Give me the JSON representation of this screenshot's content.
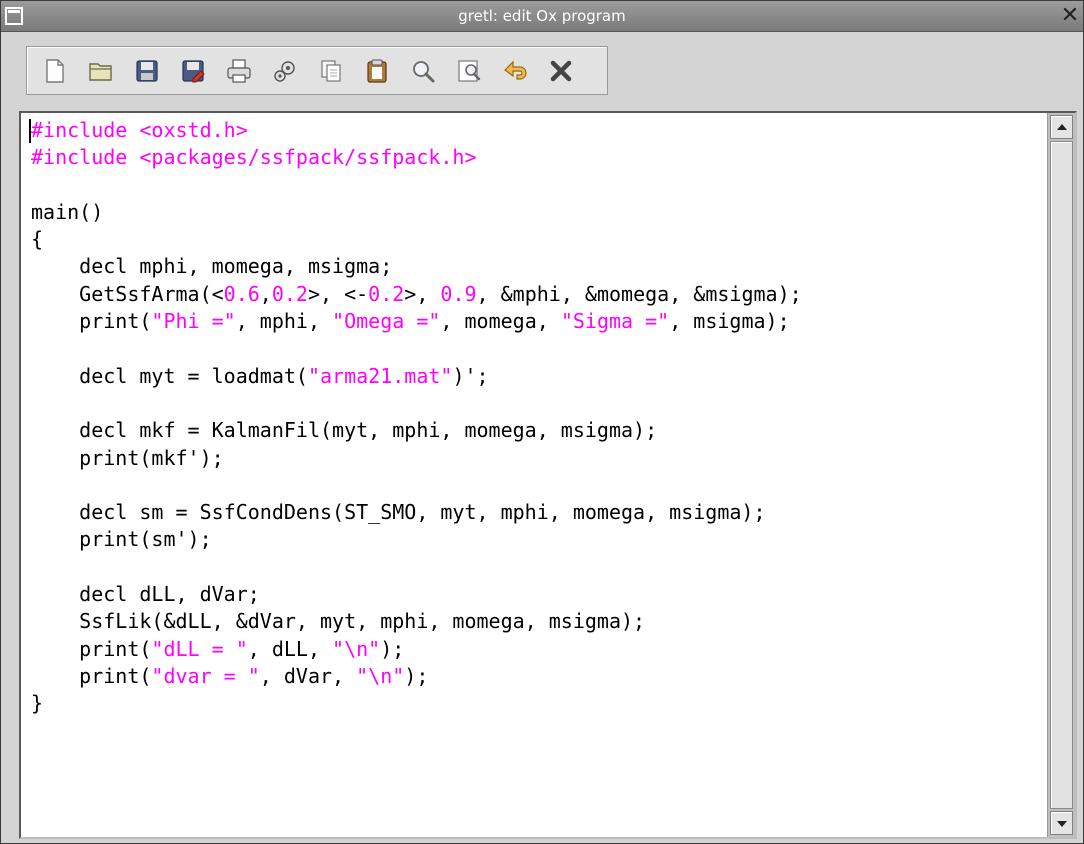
{
  "window": {
    "title": "gretl: edit Ox program",
    "close_glyph": "✕"
  },
  "toolbar": {
    "buttons": [
      {
        "icon": "new-file-icon"
      },
      {
        "icon": "open-folder-icon"
      },
      {
        "icon": "save-icon"
      },
      {
        "icon": "save-as-icon"
      },
      {
        "icon": "print-icon"
      },
      {
        "icon": "run-icon"
      },
      {
        "icon": "copy-icon"
      },
      {
        "icon": "paste-icon"
      },
      {
        "icon": "find-icon"
      },
      {
        "icon": "replace-icon"
      },
      {
        "icon": "undo-icon"
      },
      {
        "icon": "close-icon"
      }
    ]
  },
  "colors": {
    "string_literal": "#ff00ff",
    "preprocessor": "#ff00ff",
    "default_text": "#000000"
  },
  "editor": {
    "lines": [
      [
        {
          "t": "#include <oxstd.h>",
          "c": "pp"
        }
      ],
      [
        {
          "t": "#include <packages/ssfpack/ssfpack.h>",
          "c": "pp"
        }
      ],
      [],
      [
        {
          "t": "main()",
          "c": ""
        }
      ],
      [
        {
          "t": "{",
          "c": ""
        }
      ],
      [
        {
          "t": "    decl mphi, momega, msigma;",
          "c": ""
        }
      ],
      [
        {
          "t": "    GetSsfArma(<",
          "c": ""
        },
        {
          "t": "0.6",
          "c": "str"
        },
        {
          "t": ",",
          "c": ""
        },
        {
          "t": "0.2",
          "c": "str"
        },
        {
          "t": ">, <-",
          "c": ""
        },
        {
          "t": "0.2",
          "c": "str"
        },
        {
          "t": ">, ",
          "c": ""
        },
        {
          "t": "0.9",
          "c": "str"
        },
        {
          "t": ", &mphi, &momega, &msigma);",
          "c": ""
        }
      ],
      [
        {
          "t": "    print(",
          "c": ""
        },
        {
          "t": "\"Phi =\"",
          "c": "str"
        },
        {
          "t": ", mphi, ",
          "c": ""
        },
        {
          "t": "\"Omega =\"",
          "c": "str"
        },
        {
          "t": ", momega, ",
          "c": ""
        },
        {
          "t": "\"Sigma =\"",
          "c": "str"
        },
        {
          "t": ", msigma);",
          "c": ""
        }
      ],
      [],
      [
        {
          "t": "    decl myt = loadmat(",
          "c": ""
        },
        {
          "t": "\"arma21.mat\"",
          "c": "str"
        },
        {
          "t": ")';",
          "c": ""
        }
      ],
      [],
      [
        {
          "t": "    decl mkf = KalmanFil(myt, mphi, momega, msigma);",
          "c": ""
        }
      ],
      [
        {
          "t": "    print(mkf');",
          "c": ""
        }
      ],
      [],
      [
        {
          "t": "    decl sm = SsfCondDens(ST_SMO, myt, mphi, momega, msigma);",
          "c": ""
        }
      ],
      [
        {
          "t": "    print(sm');",
          "c": ""
        }
      ],
      [],
      [
        {
          "t": "    decl dLL, dVar;",
          "c": ""
        }
      ],
      [
        {
          "t": "    SsfLik(&dLL, &dVar, myt, mphi, momega, msigma);",
          "c": ""
        }
      ],
      [
        {
          "t": "    print(",
          "c": ""
        },
        {
          "t": "\"dLL = \"",
          "c": "str"
        },
        {
          "t": ", dLL, ",
          "c": ""
        },
        {
          "t": "\"\\n\"",
          "c": "str"
        },
        {
          "t": ");",
          "c": ""
        }
      ],
      [
        {
          "t": "    print(",
          "c": ""
        },
        {
          "t": "\"dvar = \"",
          "c": "str"
        },
        {
          "t": ", dVar, ",
          "c": ""
        },
        {
          "t": "\"\\n\"",
          "c": "str"
        },
        {
          "t": ");",
          "c": ""
        }
      ],
      [
        {
          "t": "}",
          "c": ""
        }
      ]
    ]
  }
}
